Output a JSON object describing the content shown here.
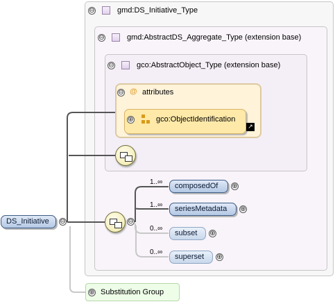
{
  "colors": {
    "outer_panel_bg": "#f7f7f7",
    "nested_panel_bg": "#f9f4fa",
    "attributes_card_bg": "#fff3da",
    "identification_card_bg": "#ffe9a8",
    "element_pill_fill": "#c7d7ee",
    "substitution_group_bg": "#eefde8"
  },
  "root_type": {
    "name": "gmd:DS_Initiative_Type",
    "icon": "complex-type-icon",
    "toggle": "⊖"
  },
  "base_type_1": {
    "name": "gmd:AbstractDS_Aggregate_Type (extension base)",
    "icon": "complex-type-icon",
    "toggle": "⊖"
  },
  "base_type_2": {
    "name": "gco:AbstractObject_Type (extension base)",
    "icon": "complex-type-icon",
    "toggle": "⊖"
  },
  "attributes": {
    "label": "attributes",
    "icon": "at-sign-icon",
    "toggle": "⊖",
    "group": {
      "name": "gco:ObjectIdentification",
      "icon": "attribute-group-icon",
      "toggle": "⊕",
      "link_icon": "arrow-link-icon"
    }
  },
  "root_element": {
    "name": "DS_Initiative",
    "toggle": "⊖"
  },
  "sequence": {
    "icon": "sequence-icon",
    "toggle": "⊖",
    "children": [
      {
        "name": "composedOf",
        "cardinality": "1..∞",
        "optional": false,
        "toggle": "⊕"
      },
      {
        "name": "seriesMetadata",
        "cardinality": "1..∞",
        "optional": false,
        "toggle": "⊕"
      },
      {
        "name": "subset",
        "cardinality": "0..∞",
        "optional": true,
        "toggle": "⊕"
      },
      {
        "name": "superset",
        "cardinality": "0..∞",
        "optional": true,
        "toggle": "⊕"
      }
    ]
  },
  "substitution_group": {
    "label": "Substitution Group",
    "toggle": "⊕"
  }
}
